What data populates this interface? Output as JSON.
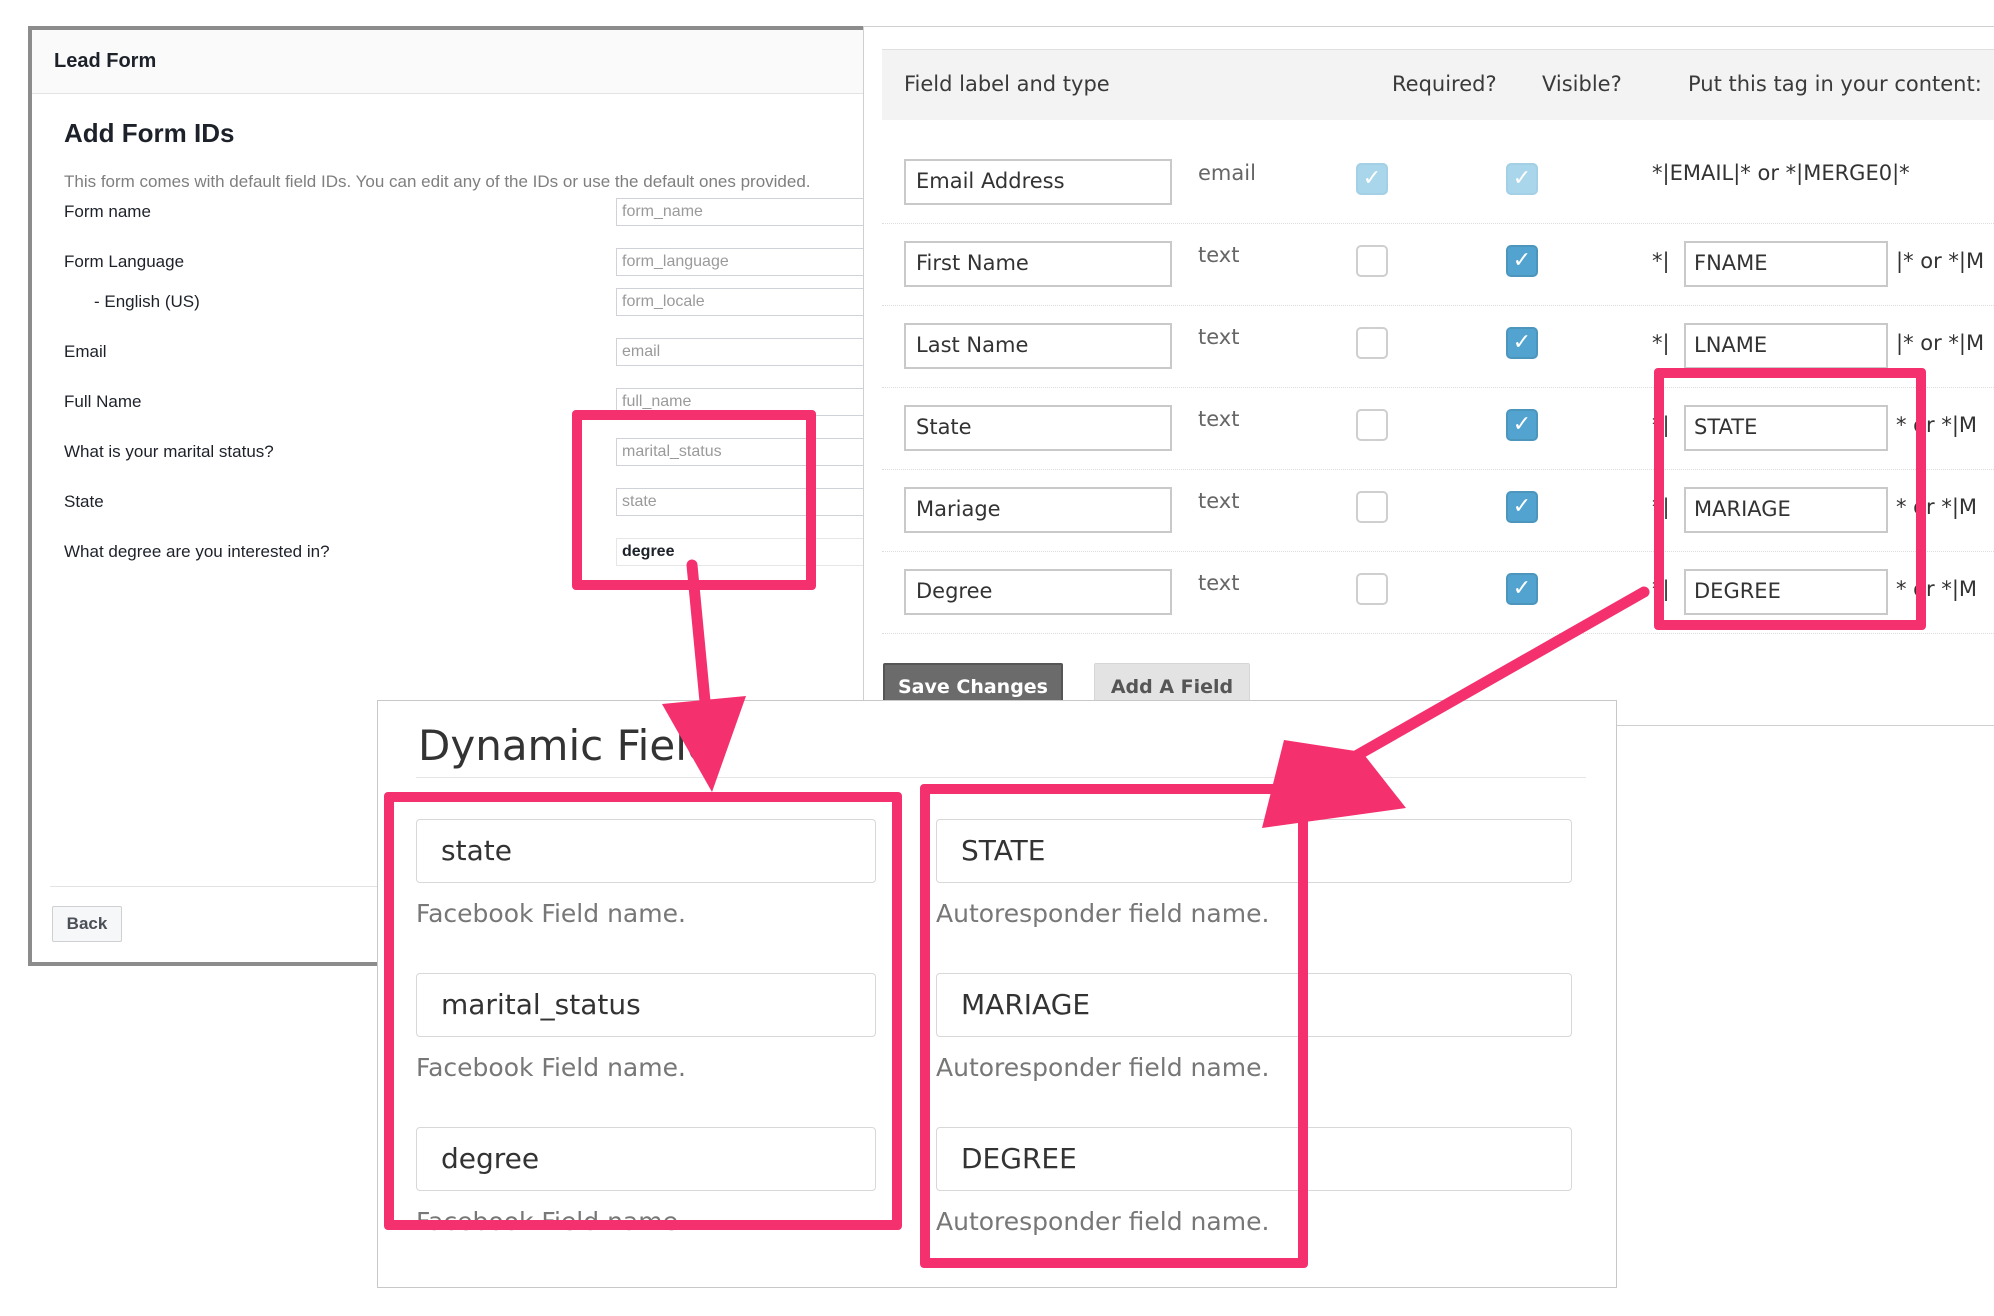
{
  "lead_form": {
    "window_title": "Lead Form",
    "heading": "Add Form IDs",
    "description": "This form comes with default field IDs. You can edit any of the IDs or use the default ones provided.",
    "fields": [
      {
        "label": "Form name",
        "value": "form_name"
      },
      {
        "label": "Form Language",
        "value": "form_language"
      },
      {
        "label": "- English (US)",
        "value": "form_locale"
      },
      {
        "label": "Email",
        "value": "email"
      },
      {
        "label": "Full Name",
        "value": "full_name"
      },
      {
        "label": "What is your marital status?",
        "value": "marital_status"
      },
      {
        "label": "State",
        "value": "state"
      },
      {
        "label": "What degree are you interested in?",
        "value": "degree"
      }
    ],
    "back_label": "Back"
  },
  "merge_table": {
    "headers": {
      "field": "Field label and type",
      "required": "Required?",
      "visible": "Visible?",
      "tag": "Put this tag in your content:"
    },
    "rows": [
      {
        "label": "Email Address",
        "type": "email",
        "tag_full": "*|EMAIL|* or *|MERGE0|*"
      },
      {
        "label": "First Name",
        "type": "text",
        "tag_prefix": "*|",
        "tag": "FNAME",
        "tag_suffix": "|* or *|M"
      },
      {
        "label": "Last Name",
        "type": "text",
        "tag_prefix": "*|",
        "tag": "LNAME",
        "tag_suffix": "|* or *|M"
      },
      {
        "label": "State",
        "type": "text",
        "tag_prefix": "*|",
        "tag": "STATE",
        "tag_suffix": "* or *|M"
      },
      {
        "label": "Mariage",
        "type": "text",
        "tag_prefix": "*|",
        "tag": "MARIAGE",
        "tag_suffix": "* or *|M"
      },
      {
        "label": "Degree",
        "type": "text",
        "tag_prefix": "*|",
        "tag": "DEGREE",
        "tag_suffix": "* or *|M"
      }
    ],
    "save_label": "Save Changes",
    "add_field_label": "Add A Field",
    "check_glyph": "✓"
  },
  "dynamic_fields": {
    "title": "Dynamic Field",
    "rows": [
      {
        "facebook": "state",
        "autoresponder": "STATE"
      },
      {
        "facebook": "marital_status",
        "autoresponder": "MARIAGE"
      },
      {
        "facebook": "degree",
        "autoresponder": "DEGREE"
      }
    ],
    "facebook_help": "Facebook Field name.",
    "autoresponder_help": "Autoresponder field name."
  },
  "colors": {
    "highlight": "#f5306f",
    "checkbox_on": "#52a3cf",
    "checkbox_disabled": "#a9d6ea"
  }
}
